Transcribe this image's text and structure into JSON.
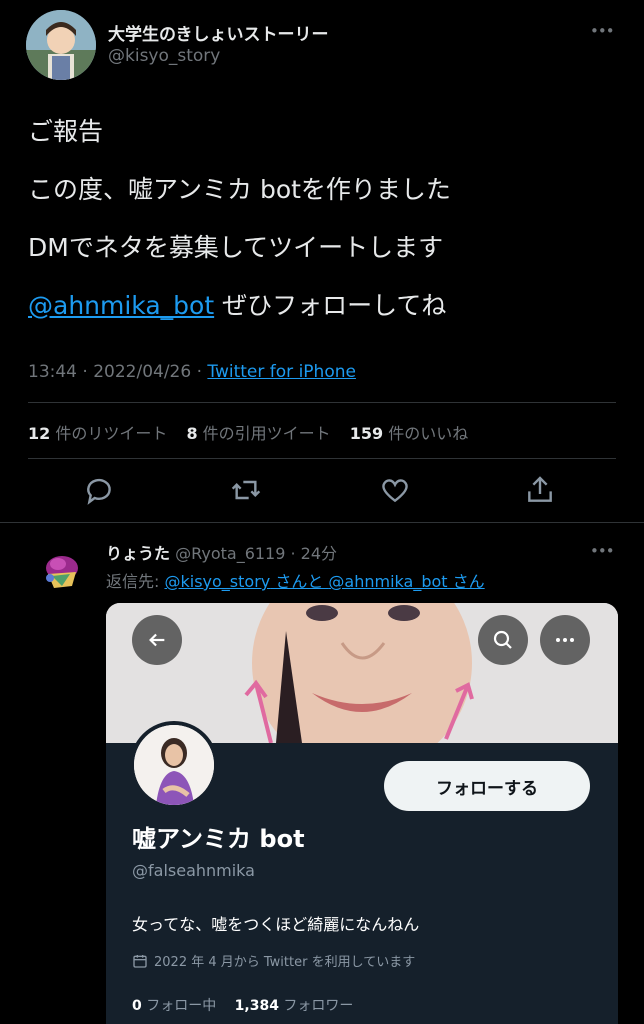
{
  "tweet": {
    "author_name": "大学生のきしょいストーリー",
    "author_handle": "@kisyo_story",
    "more_label": "•••",
    "lines": [
      "ご報告",
      "この度、嘘アンミカ botを作りました",
      "DMでネタを募集してツイートします"
    ],
    "mention": "@ahnmika_bot",
    "mention_tail": " ぜひフォローしてね",
    "time": "13:44 · 2022/04/26 · ",
    "client": "Twitter for iPhone",
    "stats": {
      "retweets_count": "12",
      "retweets_label": " 件のリツイート",
      "quotes_count": "8",
      "quotes_label": " 件の引用ツイート",
      "likes_count": "159",
      "likes_label": " 件のいいね"
    }
  },
  "reply": {
    "author_name": "りょうた",
    "author_meta": "@Ryota_6119 · 24分",
    "more_label": "•••",
    "reply_prefix": "返信先: ",
    "reply_to_1": "@kisyo_story",
    "reply_mid": " さんと ",
    "reply_to_2": "@ahnmika_bot",
    "reply_tail": " さん",
    "card": {
      "follow_label": "フォローする",
      "profile_name": "嘘アンミカ bot",
      "profile_handle": "@falseahnmika",
      "bio": "女ってな、嘘をつくほど綺麗になんねん",
      "joined": "2022 年 4 月から Twitter を利用しています",
      "following_count": "0",
      "following_label": " フォロー中",
      "followers_count": "1,384",
      "followers_label": " フォロワー"
    }
  }
}
